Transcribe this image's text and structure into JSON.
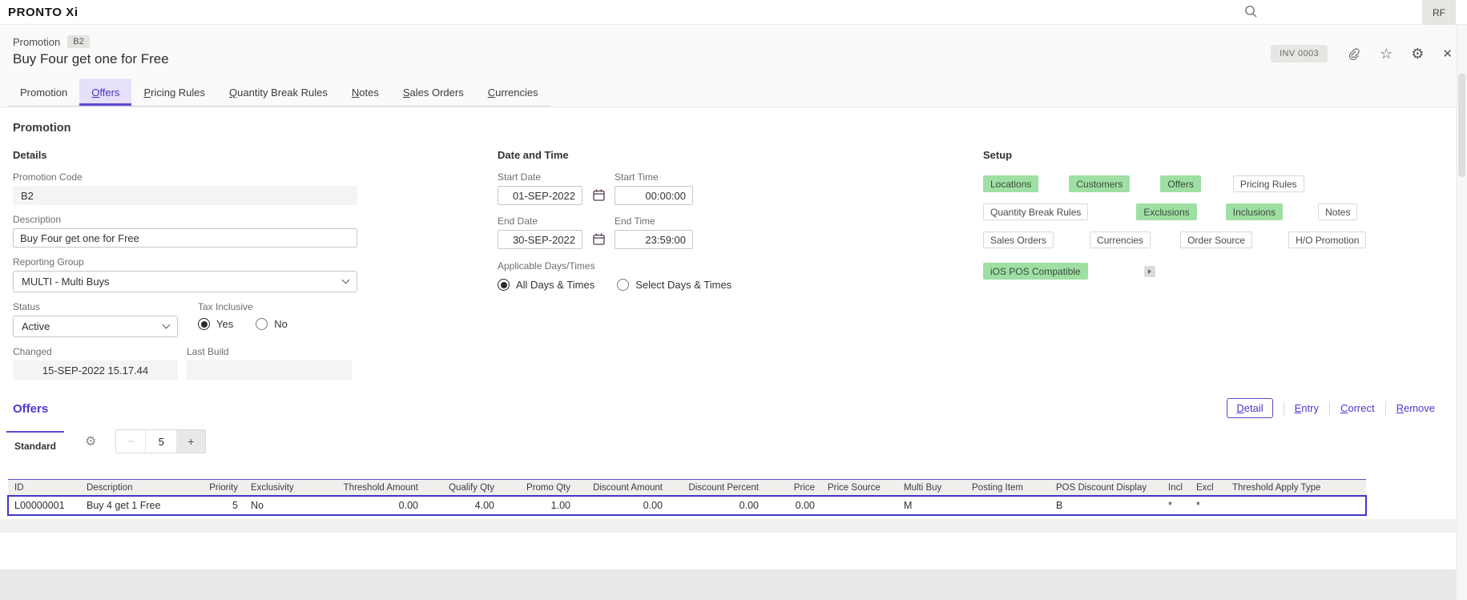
{
  "topbar": {
    "logo": "PRONTO Xi",
    "avatar": "RF"
  },
  "header": {
    "breadcrumb": "Promotion",
    "code_badge": "B2",
    "title": "Buy Four get one for Free",
    "inv_badge": "INV 0003"
  },
  "main_tabs": [
    {
      "label": "Promotion"
    },
    {
      "label": "Offers"
    },
    {
      "label": "Pricing Rules"
    },
    {
      "label": "Quantity Break Rules"
    },
    {
      "label": "Notes"
    },
    {
      "label": "Sales Orders"
    },
    {
      "label": "Currencies"
    }
  ],
  "promotion_section": {
    "title": "Promotion",
    "details": {
      "heading": "Details",
      "promotion_code_label": "Promotion Code",
      "promotion_code": "B2",
      "description_label": "Description",
      "description": "Buy Four get one for Free",
      "reporting_group_label": "Reporting Group",
      "reporting_group": "MULTI - Multi Buys",
      "status_label": "Status",
      "status": "Active",
      "tax_inclusive_label": "Tax Inclusive",
      "tax_yes": "Yes",
      "tax_no": "No",
      "tax_selected": "Yes",
      "changed_label": "Changed",
      "changed": "15-SEP-2022 15.17.44",
      "last_build_label": "Last Build",
      "last_build": ""
    },
    "date_time": {
      "heading": "Date and Time",
      "start_date_label": "Start Date",
      "start_date": "01-SEP-2022",
      "start_time_label": "Start Time",
      "start_time": "00:00:00",
      "end_date_label": "End Date",
      "end_date": "30-SEP-2022",
      "end_time_label": "End Time",
      "end_time": "23:59:00",
      "applicable_label": "Applicable Days/Times",
      "applicable_all": "All Days & Times",
      "applicable_select": "Select Days & Times",
      "applicable_selected": "All Days & Times"
    },
    "setup": {
      "heading": "Setup",
      "chips": [
        {
          "label": "Locations",
          "state": "green"
        },
        {
          "label": "Customers",
          "state": "green"
        },
        {
          "label": "Offers",
          "state": "green"
        },
        {
          "label": "Pricing Rules",
          "state": "plain"
        },
        {
          "label": "Quantity Break Rules",
          "state": "plain"
        },
        {
          "label": "Exclusions",
          "state": "green"
        },
        {
          "label": "Inclusions",
          "state": "green"
        },
        {
          "label": "Notes",
          "state": "plain"
        },
        {
          "label": "Sales Orders",
          "state": "plain"
        },
        {
          "label": "Currencies",
          "state": "plain"
        },
        {
          "label": "Order Source",
          "state": "plain"
        },
        {
          "label": "H/O Promotion",
          "state": "plain"
        },
        {
          "label": "iOS POS Compatible",
          "state": "green"
        }
      ]
    }
  },
  "offers_section": {
    "heading": "Offers",
    "actions": {
      "detail": "Detail",
      "entry": "Entry",
      "correct": "Correct",
      "remove": "Remove"
    },
    "view_tab": "Standard",
    "stepper_value": "5",
    "table": {
      "columns": [
        "ID",
        "Description",
        "Priority",
        "Exclusivity",
        "Threshold Amount",
        "Qualify Qty",
        "Promo Qty",
        "Discount Amount",
        "Discount Percent",
        "Price",
        "Price Source",
        "Multi Buy",
        "Posting Item",
        "POS Discount Display",
        "Incl",
        "Excl",
        "Threshold Apply Type"
      ],
      "rows": [
        [
          "L00000001",
          "Buy 4 get 1 Free",
          "5",
          "No",
          "0.00",
          "4.00",
          "1.00",
          "0.00",
          "0.00",
          "0.00",
          "",
          "M",
          "",
          "B",
          "*",
          "*",
          ""
        ]
      ]
    }
  },
  "colors": {
    "accent_purple": "#4b39cf",
    "active_tab_bg": "#e7e0fb",
    "chip_green": "#9fdfa4",
    "selection_border": "#4038c8"
  }
}
